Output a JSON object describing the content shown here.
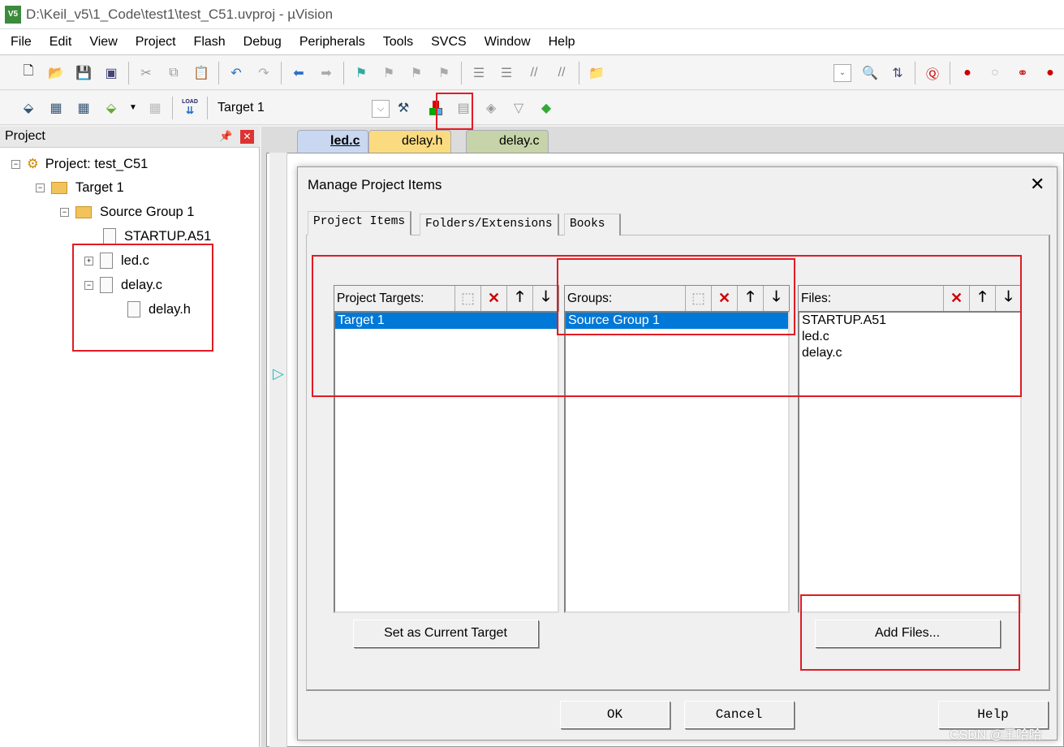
{
  "window": {
    "title": "D:\\Keil_v5\\1_Code\\test1\\test_C51.uvproj - µVision",
    "app_icon": "V5"
  },
  "menu": [
    "File",
    "Edit",
    "View",
    "Project",
    "Flash",
    "Debug",
    "Peripherals",
    "Tools",
    "SVCS",
    "Window",
    "Help"
  ],
  "toolbar2": {
    "load_label": "LOAD",
    "target": "Target 1"
  },
  "project_panel": {
    "title": "Project",
    "tree": {
      "project": "Project: test_C51",
      "target": "Target 1",
      "group": "Source Group 1",
      "files": [
        "STARTUP.A51",
        "led.c",
        "delay.c"
      ],
      "child": "delay.h"
    }
  },
  "editor": {
    "tabs": [
      "led.c",
      "delay.h",
      "delay.c"
    ]
  },
  "dialog": {
    "title": "Manage Project Items",
    "tabs": [
      "Project Items",
      "Folders/Extensions",
      "Books"
    ],
    "targets": {
      "label": "Project Targets:",
      "items": [
        "Target 1"
      ],
      "selected": "Target 1"
    },
    "groups": {
      "label": "Groups:",
      "items": [
        "Source Group 1"
      ]
    },
    "files": {
      "label": "Files:",
      "items": [
        "STARTUP.A51",
        "led.c",
        "delay.c"
      ]
    },
    "set_current_target": "Set as Current Target",
    "add_files": "Add Files...",
    "ok": "OK",
    "cancel": "Cancel",
    "help": "Help"
  },
  "watermark": "CSDN @王哈哈",
  "colors": {
    "selection": "#0078d7",
    "highlight": "#e01c24"
  }
}
